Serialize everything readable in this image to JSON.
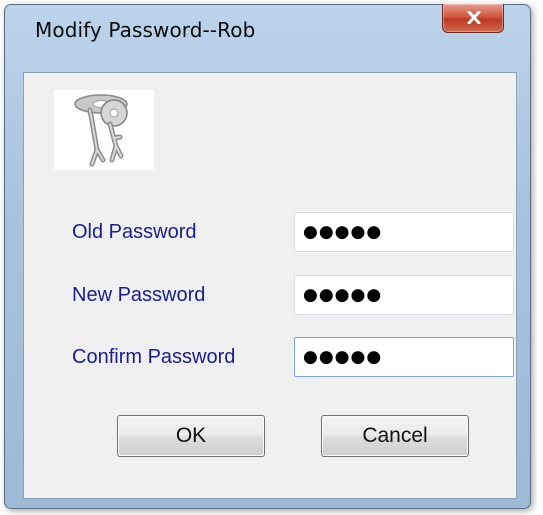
{
  "window": {
    "title": "Modify Password--Rob",
    "close_icon": "close-icon"
  },
  "form": {
    "image_icon": "key-icon",
    "old_password": {
      "label": "Old Password",
      "value": "●●●●●"
    },
    "new_password": {
      "label": "New Password",
      "value": "●●●●●"
    },
    "confirm_password": {
      "label": "Confirm Password",
      "value": "●●●●●"
    }
  },
  "buttons": {
    "ok_label": "OK",
    "cancel_label": "Cancel"
  },
  "colors": {
    "label_text": "#1b1d8f",
    "close_button": "#c8452c",
    "focus_border": "#7aa6d6"
  }
}
